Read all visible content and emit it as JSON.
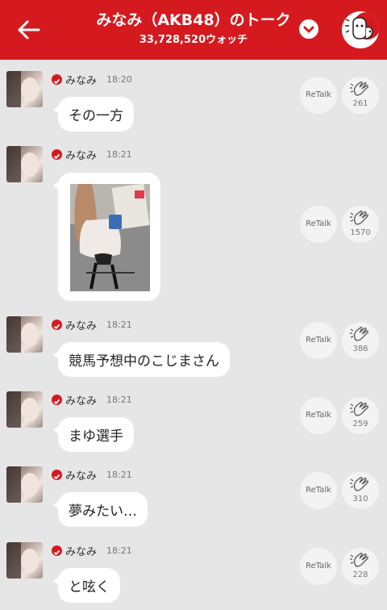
{
  "header": {
    "title": "みなみ（AKB48）のトーク",
    "watch_count": "33,728,520ウォッチ"
  },
  "retalk_label": "ReTalk",
  "messages": [
    {
      "name": "みなみ",
      "time": "18:20",
      "text": "その一方",
      "claps": "261"
    },
    {
      "name": "みなみ",
      "time": "18:21",
      "type": "image",
      "claps": "1570"
    },
    {
      "name": "みなみ",
      "time": "18:21",
      "text": "競馬予想中のこじまさん",
      "claps": "386"
    },
    {
      "name": "みなみ",
      "time": "18:21",
      "text": "まゆ選手",
      "claps": "259"
    },
    {
      "name": "みなみ",
      "time": "18:21",
      "text": "夢みたい…",
      "claps": "310"
    },
    {
      "name": "みなみ",
      "time": "18:21",
      "text": "と呟く",
      "claps": "228"
    }
  ],
  "colors": {
    "header_bg": "#d51a1f",
    "background": "#e6e6e6",
    "bubble": "#ffffff"
  }
}
